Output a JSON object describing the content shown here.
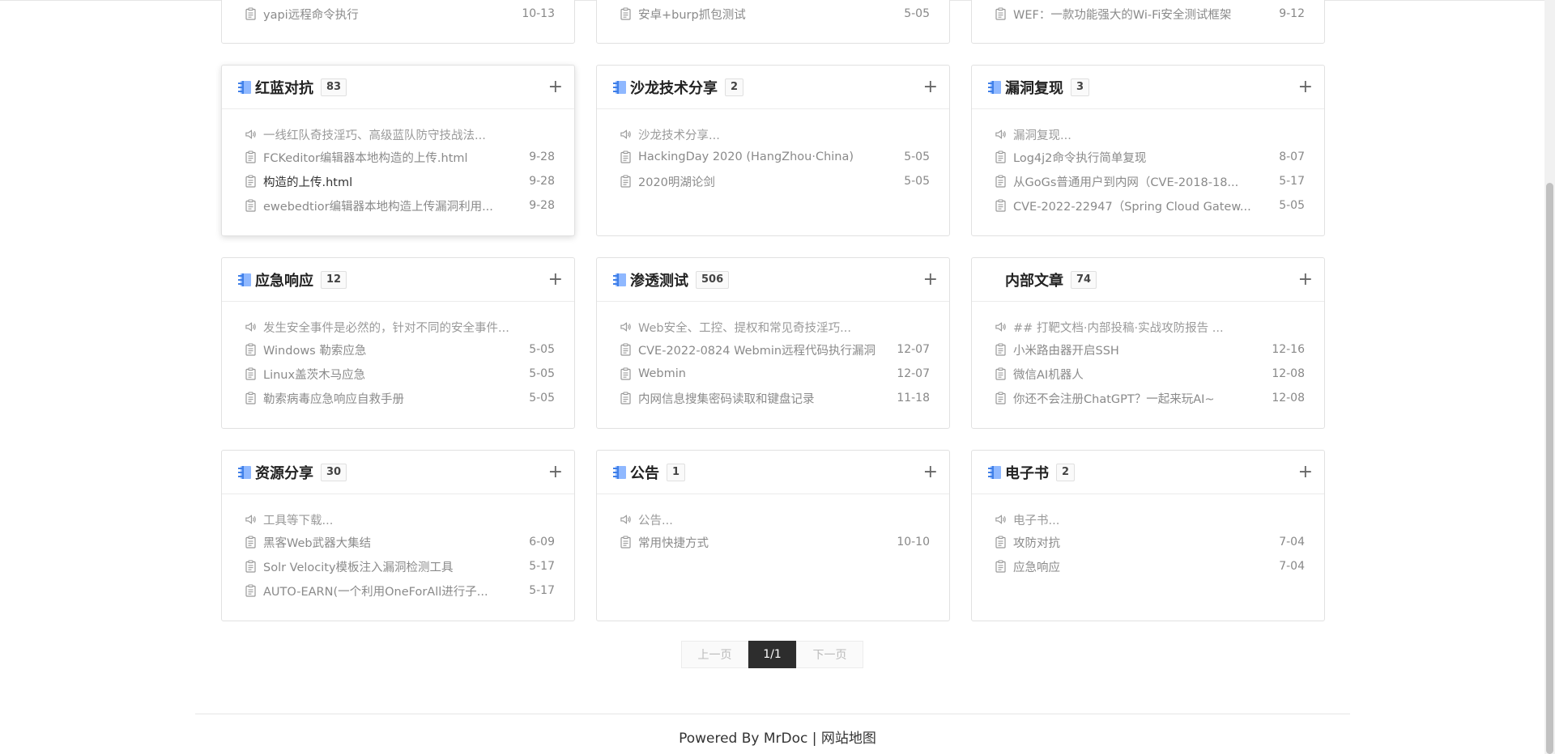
{
  "cards": [
    {
      "partial": true,
      "items": [
        {
          "kind": "doc",
          "text": "yapi远程命令执行",
          "date": "10-13"
        }
      ]
    },
    {
      "partial": true,
      "items": [
        {
          "kind": "doc",
          "text": "安卓+burp抓包测试",
          "date": "5-05"
        }
      ]
    },
    {
      "partial": true,
      "items": [
        {
          "kind": "doc",
          "text": "WEF：一款功能强大的Wi-Fi安全测试框架",
          "date": "9-12"
        }
      ]
    },
    {
      "title": "红蓝对抗",
      "count": "83",
      "hovered": true,
      "items": [
        {
          "kind": "intro",
          "text": "一线红队奇技淫巧、高级蓝队防守技战法..."
        },
        {
          "kind": "doc",
          "text": "FCKeditor编辑器本地构造的上传.html",
          "date": "9-28"
        },
        {
          "kind": "doc",
          "text": "构造的上传.html",
          "date": "9-28",
          "dark": true
        },
        {
          "kind": "doc",
          "text": "ewebedtior编辑器本地构造上传漏洞利用...",
          "date": "9-28"
        }
      ]
    },
    {
      "title": "沙龙技术分享",
      "count": "2",
      "items": [
        {
          "kind": "intro",
          "text": "沙龙技术分享..."
        },
        {
          "kind": "doc",
          "text": "HackingDay 2020 (HangZhou·China)",
          "date": "5-05"
        },
        {
          "kind": "doc",
          "text": "2020明湖论剑",
          "date": "5-05"
        }
      ]
    },
    {
      "title": "漏洞复现",
      "count": "3",
      "items": [
        {
          "kind": "intro",
          "text": "漏洞复现..."
        },
        {
          "kind": "doc",
          "text": "Log4j2命令执行简单复现",
          "date": "8-07"
        },
        {
          "kind": "doc",
          "text": "从GoGs普通用户到内网（CVE-2018-18...",
          "date": "5-17"
        },
        {
          "kind": "doc",
          "text": "CVE-2022-22947（Spring Cloud Gatew...",
          "date": "5-05"
        }
      ]
    },
    {
      "title": "应急响应",
      "count": "12",
      "items": [
        {
          "kind": "intro",
          "text": "发生安全事件是必然的，针对不同的安全事件..."
        },
        {
          "kind": "doc",
          "text": "Windows 勒索应急",
          "date": "5-05"
        },
        {
          "kind": "doc",
          "text": "Linux盖茨木马应急",
          "date": "5-05"
        },
        {
          "kind": "doc",
          "text": "勒索病毒应急响应自救手册",
          "date": "5-05"
        }
      ]
    },
    {
      "title": "渗透测试",
      "count": "506",
      "items": [
        {
          "kind": "intro",
          "text": "Web安全、工控、提权和常见奇技淫巧..."
        },
        {
          "kind": "doc",
          "text": "CVE-2022-0824 Webmin远程代码执行漏洞",
          "date": "12-07"
        },
        {
          "kind": "doc",
          "text": "Webmin",
          "date": "12-07"
        },
        {
          "kind": "doc",
          "text": "内网信息搜集密码读取和键盘记录",
          "date": "11-18"
        }
      ]
    },
    {
      "title": "内部文章",
      "count": "74",
      "noIcon": true,
      "items": [
        {
          "kind": "intro",
          "text": "## 打靶文档·内部投稿·实战攻防报告 ..."
        },
        {
          "kind": "doc",
          "text": "小米路由器开启SSH",
          "date": "12-16"
        },
        {
          "kind": "doc",
          "text": "微信AI机器人",
          "date": "12-08"
        },
        {
          "kind": "doc",
          "text": "你还不会注册ChatGPT？一起来玩AI~",
          "date": "12-08"
        }
      ]
    },
    {
      "title": "资源分享",
      "count": "30",
      "items": [
        {
          "kind": "intro",
          "text": "工具等下载..."
        },
        {
          "kind": "doc",
          "text": "黑客Web武器大集结",
          "date": "6-09"
        },
        {
          "kind": "doc",
          "text": "Solr Velocity模板注入漏洞检测工具",
          "date": "5-17"
        },
        {
          "kind": "doc",
          "text": "AUTO-EARN(一个利用OneForAll进行子...",
          "date": "5-17"
        }
      ]
    },
    {
      "title": "公告",
      "count": "1",
      "items": [
        {
          "kind": "intro",
          "text": "公告..."
        },
        {
          "kind": "doc",
          "text": "常用快捷方式",
          "date": "10-10"
        }
      ]
    },
    {
      "title": "电子书",
      "count": "2",
      "items": [
        {
          "kind": "intro",
          "text": "电子书..."
        },
        {
          "kind": "doc",
          "text": "攻防对抗",
          "date": "7-04"
        },
        {
          "kind": "doc",
          "text": "应急响应",
          "date": "7-04"
        }
      ]
    }
  ],
  "pager": {
    "prev": "上一页",
    "current": "1/1",
    "next": "下一页"
  },
  "footer": {
    "powered": "Powered By MrDoc",
    "separator": "|",
    "sitemap": "网站地图"
  },
  "icons": {
    "book": "book-icon",
    "plus": "plus-icon",
    "intro": "speaker-icon",
    "doc": "document-icon"
  },
  "colors": {
    "accent": "#3f8cff",
    "pager_active": "#2d2d2d"
  }
}
